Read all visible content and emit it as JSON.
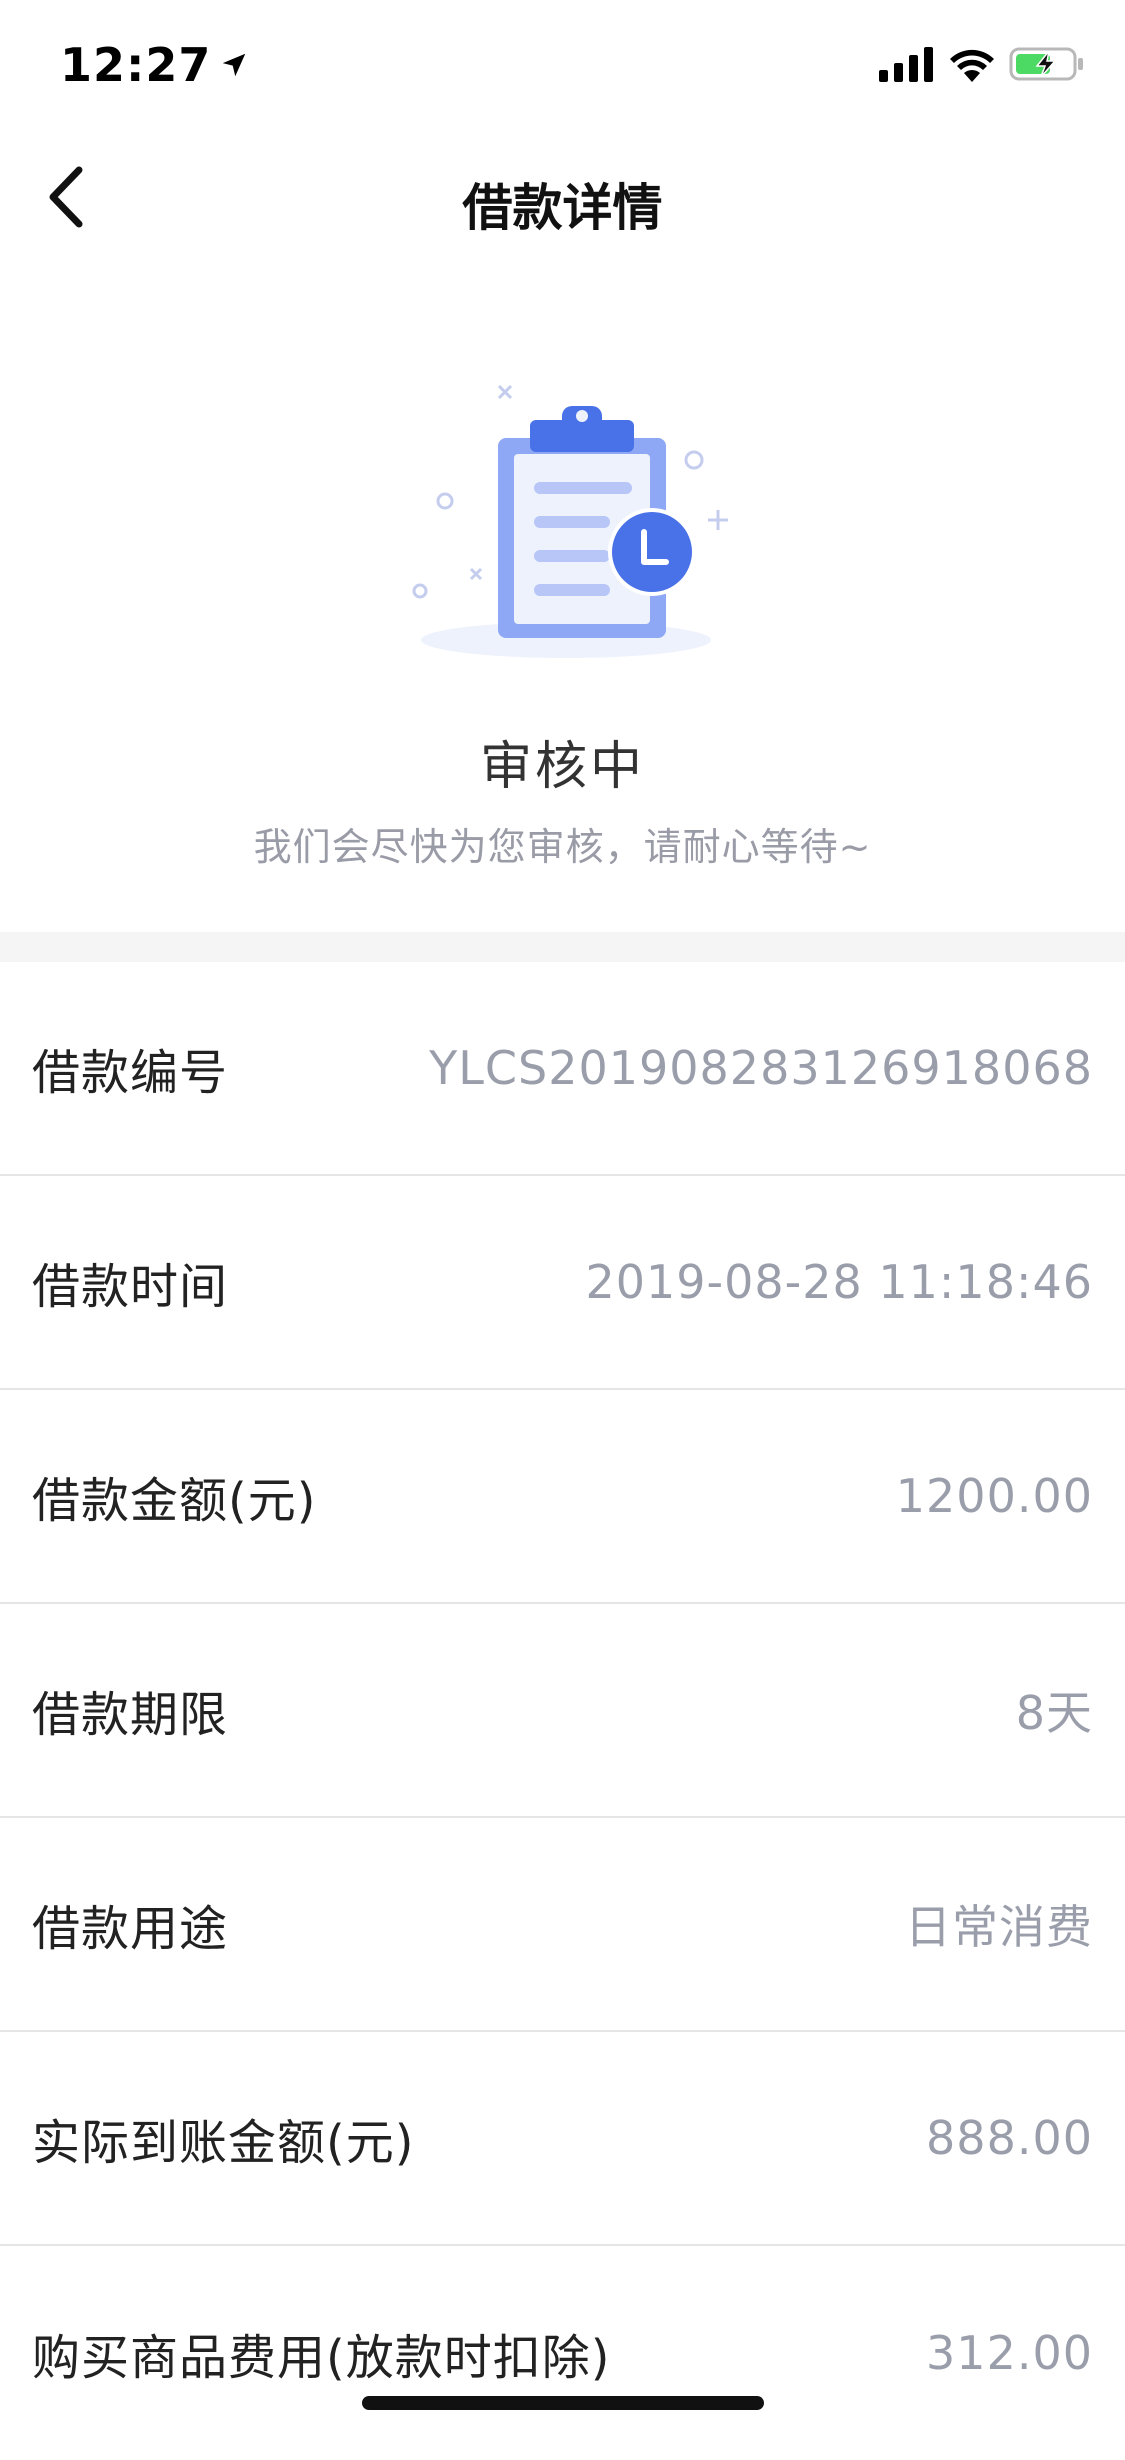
{
  "status_bar": {
    "time": "12:27",
    "icons": [
      "location-arrow-icon",
      "signal-icon",
      "wifi-icon",
      "battery-charging-icon"
    ]
  },
  "nav": {
    "title": "借款详情",
    "back_icon": "chevron-left-icon"
  },
  "hero": {
    "illustration": "clipboard-clock-icon",
    "title": "审核中",
    "subtitle": "我们会尽快为您审核，请耐心等待~"
  },
  "details": [
    {
      "label": "借款编号",
      "value": "YLCS201908283126918068"
    },
    {
      "label": "借款时间",
      "value": "2019-08-28 11:18:46"
    },
    {
      "label": "借款金额(元)",
      "value": "1200.00"
    },
    {
      "label": "借款期限",
      "value": "8天"
    },
    {
      "label": "借款用途",
      "value": "日常消费"
    },
    {
      "label": "实际到账金额(元)",
      "value": "888.00"
    },
    {
      "label": "购买商品费用(放款时扣除)",
      "value": "312.00"
    }
  ],
  "colors": {
    "accent": "#4a72e8",
    "accent_light": "#8ea8f5",
    "label": "#222222",
    "value": "#9a9eab",
    "divider": "#e6e6e6",
    "section_bg": "#f5f5f5",
    "battery": "#4cd964"
  }
}
